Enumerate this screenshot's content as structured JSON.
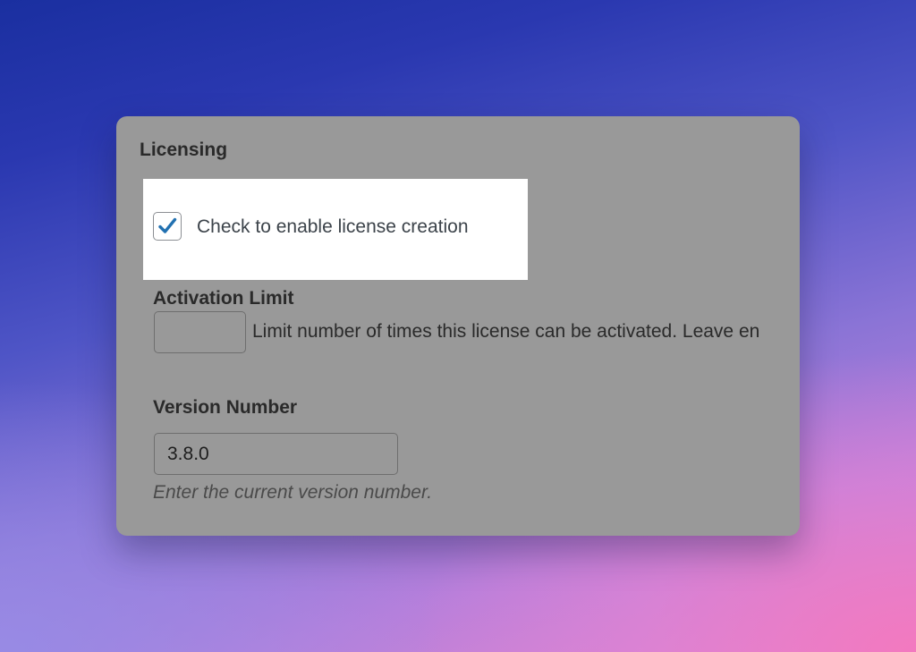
{
  "panel": {
    "title": "Licensing"
  },
  "license_creation": {
    "checked": true,
    "label": "Check to enable license creation"
  },
  "activation_limit": {
    "label": "Activation Limit",
    "value": "",
    "description": "Limit number of times this license can be activated. Leave en"
  },
  "version_number": {
    "label": "Version Number",
    "value": "3.8.0",
    "description": "Enter the current version number."
  },
  "colors": {
    "checkmark": "#2271b1",
    "panel_overlay": "#999999",
    "highlight": "#ffffff"
  },
  "icons": {
    "checkbox_mark": "checkmark-icon"
  }
}
